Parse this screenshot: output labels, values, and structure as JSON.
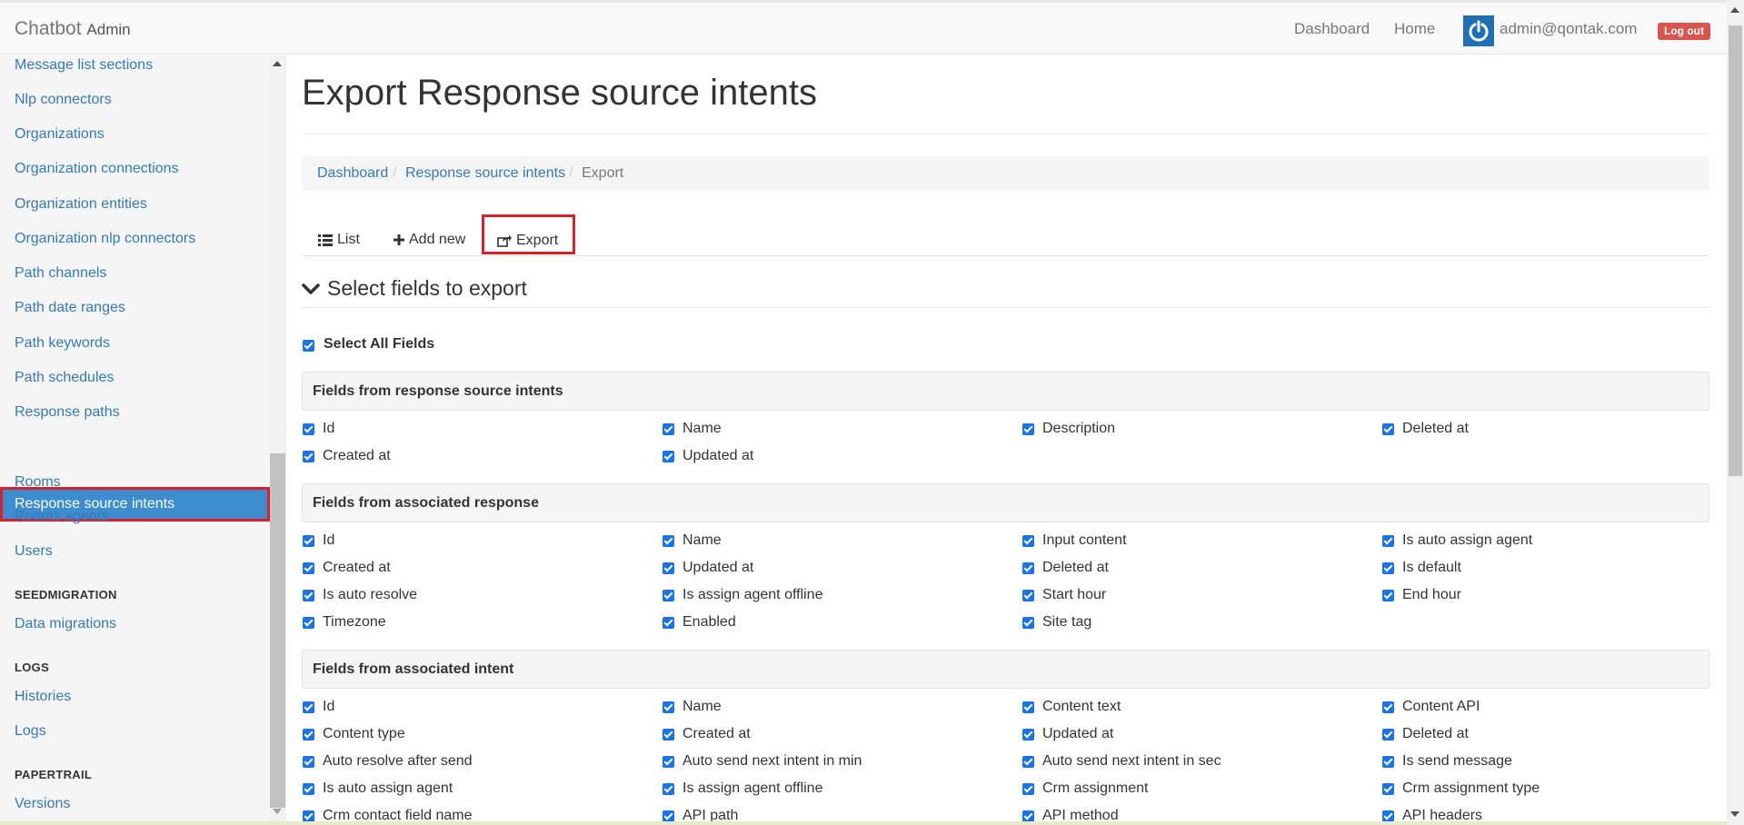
{
  "navbar": {
    "brand": "Chatbot",
    "brand_sub": "Admin",
    "links": [
      "Dashboard",
      "Home"
    ],
    "user_email": "admin@qontak.com",
    "logout_label": "Log out"
  },
  "sidebar": {
    "items_top": [
      "Message list sections",
      "Nlp connectors",
      "Organizations",
      "Organization connections",
      "Organization entities",
      "Organization nlp connectors",
      "Path channels",
      "Path date ranges",
      "Path keywords",
      "Path schedules",
      "Response paths"
    ],
    "active_item": "Response source intents",
    "items_after": [
      "Rooms",
      "Rooms agents",
      "Users"
    ],
    "seed_header": "SEEDMIGRATION",
    "seed_items": [
      "Data migrations"
    ],
    "logs_header": "LOGS",
    "logs_items": [
      "Histories",
      "Logs"
    ],
    "papertrail_header": "PAPERTRAIL",
    "papertrail_items": [
      "Versions"
    ]
  },
  "main": {
    "title": "Export Response source intents",
    "breadcrumb": [
      "Dashboard",
      "Response source intents",
      "Export"
    ],
    "tabs": {
      "list": "List",
      "add_new": "Add new",
      "export": "Export"
    },
    "section_title": "Select fields to export",
    "select_all": "Select All Fields",
    "groups": [
      {
        "title": "Fields from response source intents",
        "fields": [
          "Id",
          "Name",
          "Description",
          "Deleted at",
          "Created at",
          "Updated at"
        ]
      },
      {
        "title": "Fields from associated response",
        "fields": [
          "Id",
          "Name",
          "Input content",
          "Is auto assign agent",
          "Created at",
          "Updated at",
          "Deleted at",
          "Is default",
          "Is auto resolve",
          "Is assign agent offline",
          "Start hour",
          "End hour",
          "Timezone",
          "Enabled",
          "Site tag"
        ]
      },
      {
        "title": "Fields from associated intent",
        "fields": [
          "Id",
          "Name",
          "Content text",
          "Content API",
          "Content type",
          "Created at",
          "Updated at",
          "Deleted at",
          "Auto resolve after send",
          "Auto send next intent in min",
          "Auto send next intent in sec",
          "Is send message",
          "Is auto assign agent",
          "Is assign agent offline",
          "Crm assignment",
          "Crm assignment type",
          "Crm contact field name",
          "API path",
          "API method",
          "API headers"
        ]
      }
    ]
  },
  "colors": {
    "link": "#337ab7",
    "active": "#3c8dd0",
    "highlight": "#d9202b",
    "logout": "#d9534f",
    "checkbox": "#1a73e8"
  }
}
